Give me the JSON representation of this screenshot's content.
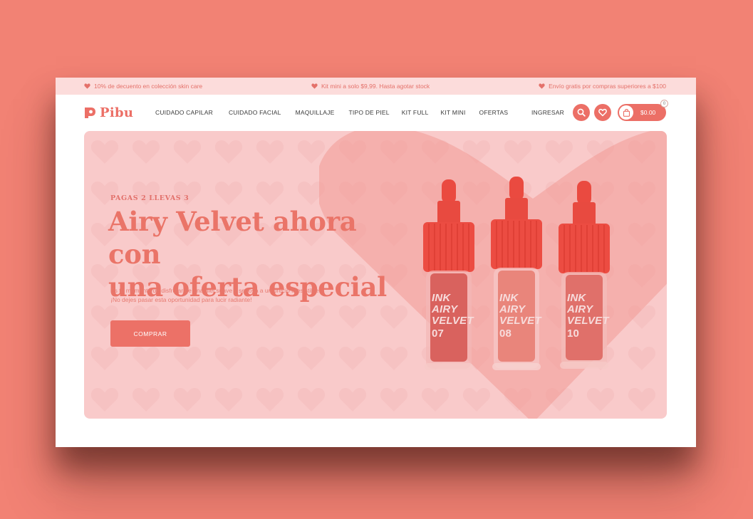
{
  "colors": {
    "page_background": "#f28274",
    "accent": "#ec6f66",
    "topbar": "#fcdcdb",
    "hero_background": "#f9caca",
    "bottle_cap": "#e8463c"
  },
  "topbar": {
    "promos": [
      {
        "icon": "heart-icon",
        "text": "10% de decuento en colección skin care"
      },
      {
        "icon": "heart-icon",
        "text": "Kit mini a solo $9,99. Hasta agotar stock"
      },
      {
        "icon": "heart-icon",
        "text": "Envío gratis por compras superiores a $100"
      }
    ]
  },
  "header": {
    "logo_text": "Pibu",
    "nav": [
      "CUIDADO CAPILAR",
      "CUIDADO FACIAL",
      "MAQUILLAJE",
      "TIPO DE PIEL",
      "KIT FULL",
      "KIT MINI",
      "OFERTAS"
    ],
    "login_label": "INGRESAR",
    "cart": {
      "total": "$0.00",
      "count": "0"
    }
  },
  "hero": {
    "eyebrow": "PAGAS 2 LLEVAS 3",
    "headline_line1": "Airy Velvet ahora con",
    "headline_line2": "una oferta especial",
    "text_line1": "Es tu momento de disfrutar de una piel suave y sedosa a un precio irresistible.",
    "text_line2": "¡No dejes pasar esta oportunidad para lucir radiante!",
    "button_label": "COMPRAR",
    "products": [
      {
        "brand": "INK",
        "line1": "AIRY",
        "line2": "VELVET",
        "shade": "07",
        "body_color": "#d9625e"
      },
      {
        "brand": "INK",
        "line1": "AIRY",
        "line2": "VELVET",
        "shade": "08",
        "body_color": "#e9857b"
      },
      {
        "brand": "INK",
        "line1": "AIRY",
        "line2": "VELVET",
        "shade": "10",
        "body_color": "#e0706a"
      }
    ]
  }
}
